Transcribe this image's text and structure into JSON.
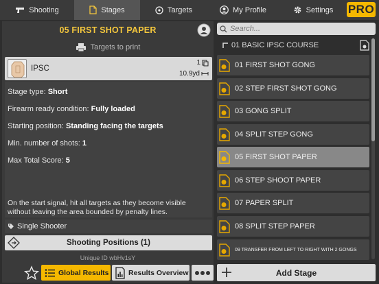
{
  "nav": {
    "tabs": [
      {
        "label": "Shooting",
        "icon": "pistol-icon"
      },
      {
        "label": "Stages",
        "icon": "document-icon"
      },
      {
        "label": "Targets",
        "icon": "target-icon"
      },
      {
        "label": "My Profile",
        "icon": "person-icon"
      },
      {
        "label": "Settings",
        "icon": "gear-icon"
      }
    ],
    "active_tab": "Stages",
    "pro_label": "PRO"
  },
  "stage_detail": {
    "title": "05 FIRST SHOT PAPER",
    "print_label": "Targets to print",
    "target": {
      "name": "IPSC",
      "count": "1",
      "distance": "10.9yd"
    },
    "fields": [
      {
        "label": "Stage type: ",
        "value": "Short"
      },
      {
        "label": "Firearm ready condition: ",
        "value": "Fully loaded"
      },
      {
        "label": "Starting position: ",
        "value": "Standing facing the targets"
      },
      {
        "label": "Min. number of shots: ",
        "value": "1"
      },
      {
        "label": "Max Total Score: ",
        "value": "5"
      }
    ],
    "description": "On the start signal, hit all targets as they become visible without leaving the area bounded by penalty lines.",
    "tag": "Single Shooter",
    "positions_button": "Shooting Positions (1)",
    "unique_id": "Unique ID  wbHv1sY",
    "global_results_label": "Global Results",
    "results_overview_label": "Results Overview"
  },
  "stage_list": {
    "search_placeholder": "Search...",
    "course_name": "01 BASIC IPSC COURSE",
    "selected": "05 FIRST SHOT PAPER",
    "items": [
      "01 FIRST SHOT GONG",
      "02 STEP FIRST SHOT GONG",
      "03 GONG SPLIT",
      "04 SPLIT STEP GONG",
      "05 FIRST SHOT PAPER",
      "06 STEP SHOOT PAPER",
      "07 PAPER SPLIT",
      "08 SPLIT STEP PAPER",
      "09 TRANSFER FROM LEFT TO RIGHT WITH 2 GONGS"
    ],
    "add_label": "Add Stage"
  },
  "colors": {
    "accent": "#f5b800",
    "title_yellow": "#f3c63d",
    "panel": "#3a3a3a",
    "background": "#2e2e2e"
  }
}
